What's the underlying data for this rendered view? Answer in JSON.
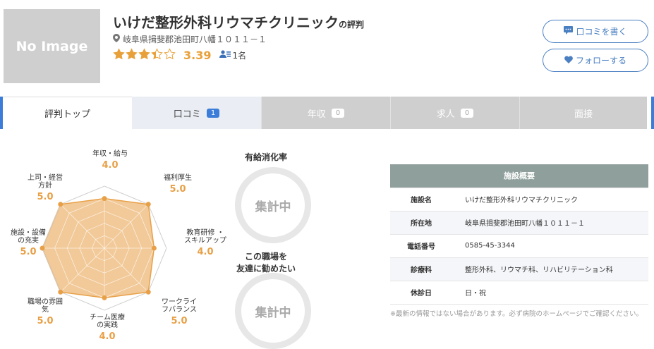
{
  "header": {
    "no_image": "No Image",
    "title": "いけだ整形外科リウマチクリニック",
    "title_suffix": "の評判",
    "address": "岐阜県揖斐郡池田町八幡１０１１－１",
    "rating": "3.39",
    "rating_stars": 3.39,
    "reviewers": "1名"
  },
  "buttons": {
    "write_review": "口コミを書く",
    "follow": "フォローする"
  },
  "tabs": [
    {
      "label": "評判トップ",
      "badge": ""
    },
    {
      "label": "口コミ",
      "badge": "1"
    },
    {
      "label": "年収",
      "badge": "0"
    },
    {
      "label": "求人",
      "badge": "0"
    },
    {
      "label": "面接",
      "badge": ""
    }
  ],
  "radar": {
    "axes": [
      {
        "label": "年収・給与",
        "value": "4.0",
        "score": 4.0
      },
      {
        "label": "福利厚生",
        "value": "5.0",
        "score": 5.0
      },
      {
        "label": "教育研修 ・\nスキルアップ",
        "value": "4.0",
        "score": 4.0
      },
      {
        "label": "ワークライ\nフバランス",
        "value": "5.0",
        "score": 5.0
      },
      {
        "label": "チーム医療\nの実践",
        "value": "4.0",
        "score": 4.0
      },
      {
        "label": "職場の雰囲\n気",
        "value": "5.0",
        "score": 5.0
      },
      {
        "label": "施設・設備\nの充実",
        "value": "5.0",
        "score": 5.0
      },
      {
        "label": "上司・経営\n方針",
        "value": "5.0",
        "score": 5.0
      }
    ],
    "max": 5,
    "colors": {
      "fill": "#f0bf86",
      "stroke": "#e8a047",
      "value": "#e8a047"
    }
  },
  "gauges": {
    "paid_leave_title": "有給消化率",
    "paid_leave_value": "集計中",
    "recommend_title": "この職場を\n友達に勧めたい",
    "recommend_value": "集計中"
  },
  "facility": {
    "heading": "施設概要",
    "rows": [
      {
        "label": "施設名",
        "value": "いけだ整形外科リウマチクリニック"
      },
      {
        "label": "所在地",
        "value": "岐阜県揖斐郡池田町八幡１０１１－１"
      },
      {
        "label": "電話番号",
        "value": "0585-45-3344"
      },
      {
        "label": "診療科",
        "value": "整形外科、リウマチ科、リハビリテーション科"
      },
      {
        "label": "休診日",
        "value": "日・祝"
      }
    ],
    "note": "※最新の情報ではない場合があります。必ず病院のホームページでご確認ください。"
  }
}
